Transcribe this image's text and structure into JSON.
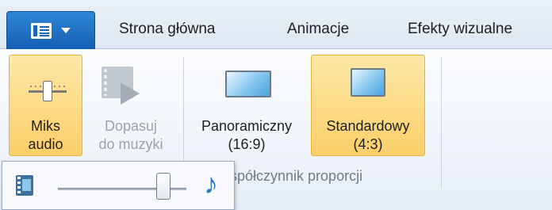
{
  "tabs": {
    "home": "Strona główna",
    "animations": "Animacje",
    "visual_effects": "Efekty wizualne"
  },
  "ribbon": {
    "audio_mix": {
      "line1": "Miks",
      "line2": "audio",
      "icon": "slider-icon"
    },
    "fit_to_music": {
      "line1": "Dopasuj",
      "line2": "do muzyki",
      "icon": "fit-to-music-icon"
    },
    "widescreen": {
      "line1": "Panoramiczny",
      "line2": "(16:9)",
      "icon": "widescreen-icon"
    },
    "standard": {
      "line1": "Standardowy",
      "line2": "(4:3)",
      "icon": "standard-screen-icon"
    },
    "aspect_group_label": "spółczynnik proporcji"
  },
  "audio_mix_popup": {
    "left_icon": "film-icon",
    "right_icon": "music-note-icon",
    "right_glyph": "♪",
    "slider_value": 0.77
  },
  "colors": {
    "highlight": "#fbcf6a",
    "app_button": "#1c67bb"
  }
}
